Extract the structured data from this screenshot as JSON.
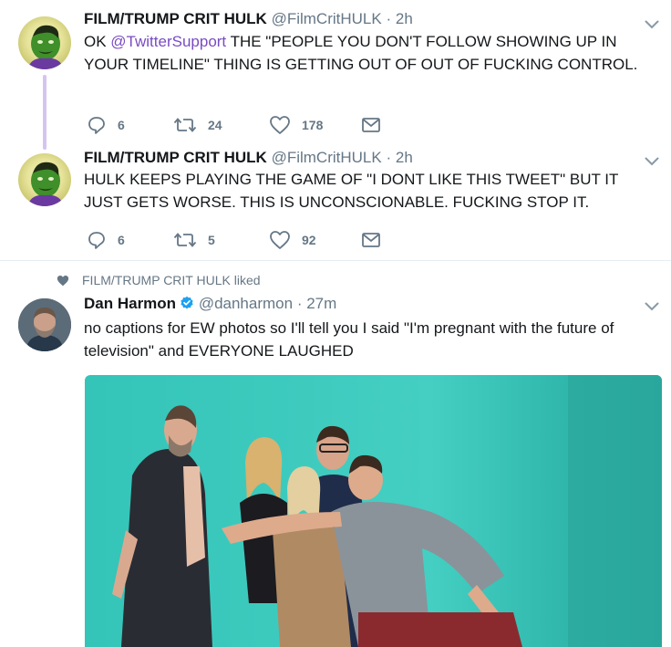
{
  "tweets": [
    {
      "name": "FILM/TRUMP CRIT HULK",
      "handle": "@FilmCritHULK",
      "separator": "·",
      "time": "2h",
      "text_pre": "OK ",
      "mention": "@TwitterSupport",
      "text_post": " THE \"PEOPLE YOU DON'T FOLLOW SHOWING UP IN YOUR TIMELINE\" THING IS GETTING OUT OF OUT OF FUCKING CONTROL.",
      "replies": "6",
      "retweets": "24",
      "likes": "178"
    },
    {
      "name": "FILM/TRUMP CRIT HULK",
      "handle": "@FilmCritHULK",
      "separator": "·",
      "time": "2h",
      "text": "HULK KEEPS PLAYING THE GAME OF \"I DONT LIKE THIS TWEET\" BUT IT JUST GETS WORSE. THIS IS UNCONSCIONABLE. FUCKING STOP IT.",
      "replies": "6",
      "retweets": "5",
      "likes": "92"
    },
    {
      "liked_by": "FILM/TRUMP CRIT HULK liked",
      "name": "Dan Harmon",
      "handle": "@danharmon",
      "separator": "·",
      "time": "27m",
      "text": "no captions for EW photos so I'll tell you I said \"I'm pregnant with the future of television\" and EVERYONE LAUGHED"
    }
  ],
  "icons": {
    "reply": "reply-icon",
    "retweet": "retweet-icon",
    "like": "heart-icon",
    "dm": "envelope-icon",
    "menu": "chevron-down-icon",
    "verified": "verified-badge-icon"
  },
  "colors": {
    "mention": "#794bc4",
    "thread_line": "#d6c4f0",
    "muted": "#657786",
    "verified": "#1da1f2",
    "photo_bg": "#3ecabd"
  }
}
